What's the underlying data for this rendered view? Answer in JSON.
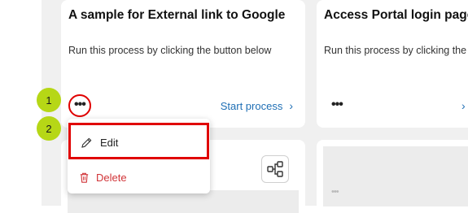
{
  "cards": [
    {
      "title": "A sample for External link to Google",
      "description": "Run this process by clicking the button below",
      "more_label": "•••",
      "start_label": "Start process",
      "start_chevron": "›"
    },
    {
      "title": "Access Portal login page",
      "description": "Run this process by clicking the",
      "more_label": "•••",
      "start_chevron": "›"
    }
  ],
  "context_menu": {
    "items": [
      {
        "label": "Edit",
        "icon": "pencil-icon"
      },
      {
        "label": "Delete",
        "icon": "trash-icon"
      }
    ]
  },
  "callouts": [
    "1",
    "2"
  ],
  "colors": {
    "highlight": "#e00000",
    "callout": "#b6d716",
    "link": "#1f6fb5",
    "delete": "#d13438"
  }
}
